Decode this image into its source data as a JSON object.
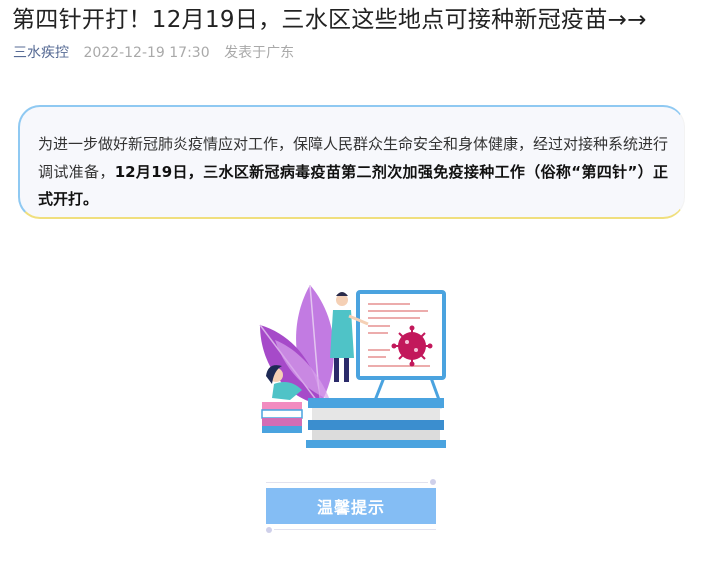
{
  "article": {
    "title": "第四针开打！12月19日，三水区这些地点可接种新冠疫苗→→",
    "account": "三水疾控",
    "date": "2022-12-19 17:30",
    "location": "发表于广东"
  },
  "intro": {
    "part1": "为进一步做好新冠肺炎疫情应对工作，保障人民群众生命安全和身体健康，经过对接种系统进行调试准备，",
    "bold": "12月19日，三水区新冠病毒疫苗第二剂次加强免疫接种工作（俗称“第四针”）正式开打。"
  },
  "illustration": {
    "icon": "vaccine-illustration-icon",
    "virus_color": "#c2185b",
    "board_frame_color": "#4aa3df",
    "leaf_color": "#b35ad9"
  },
  "tips": {
    "label": "温馨提示",
    "color": "#84bdf4"
  }
}
